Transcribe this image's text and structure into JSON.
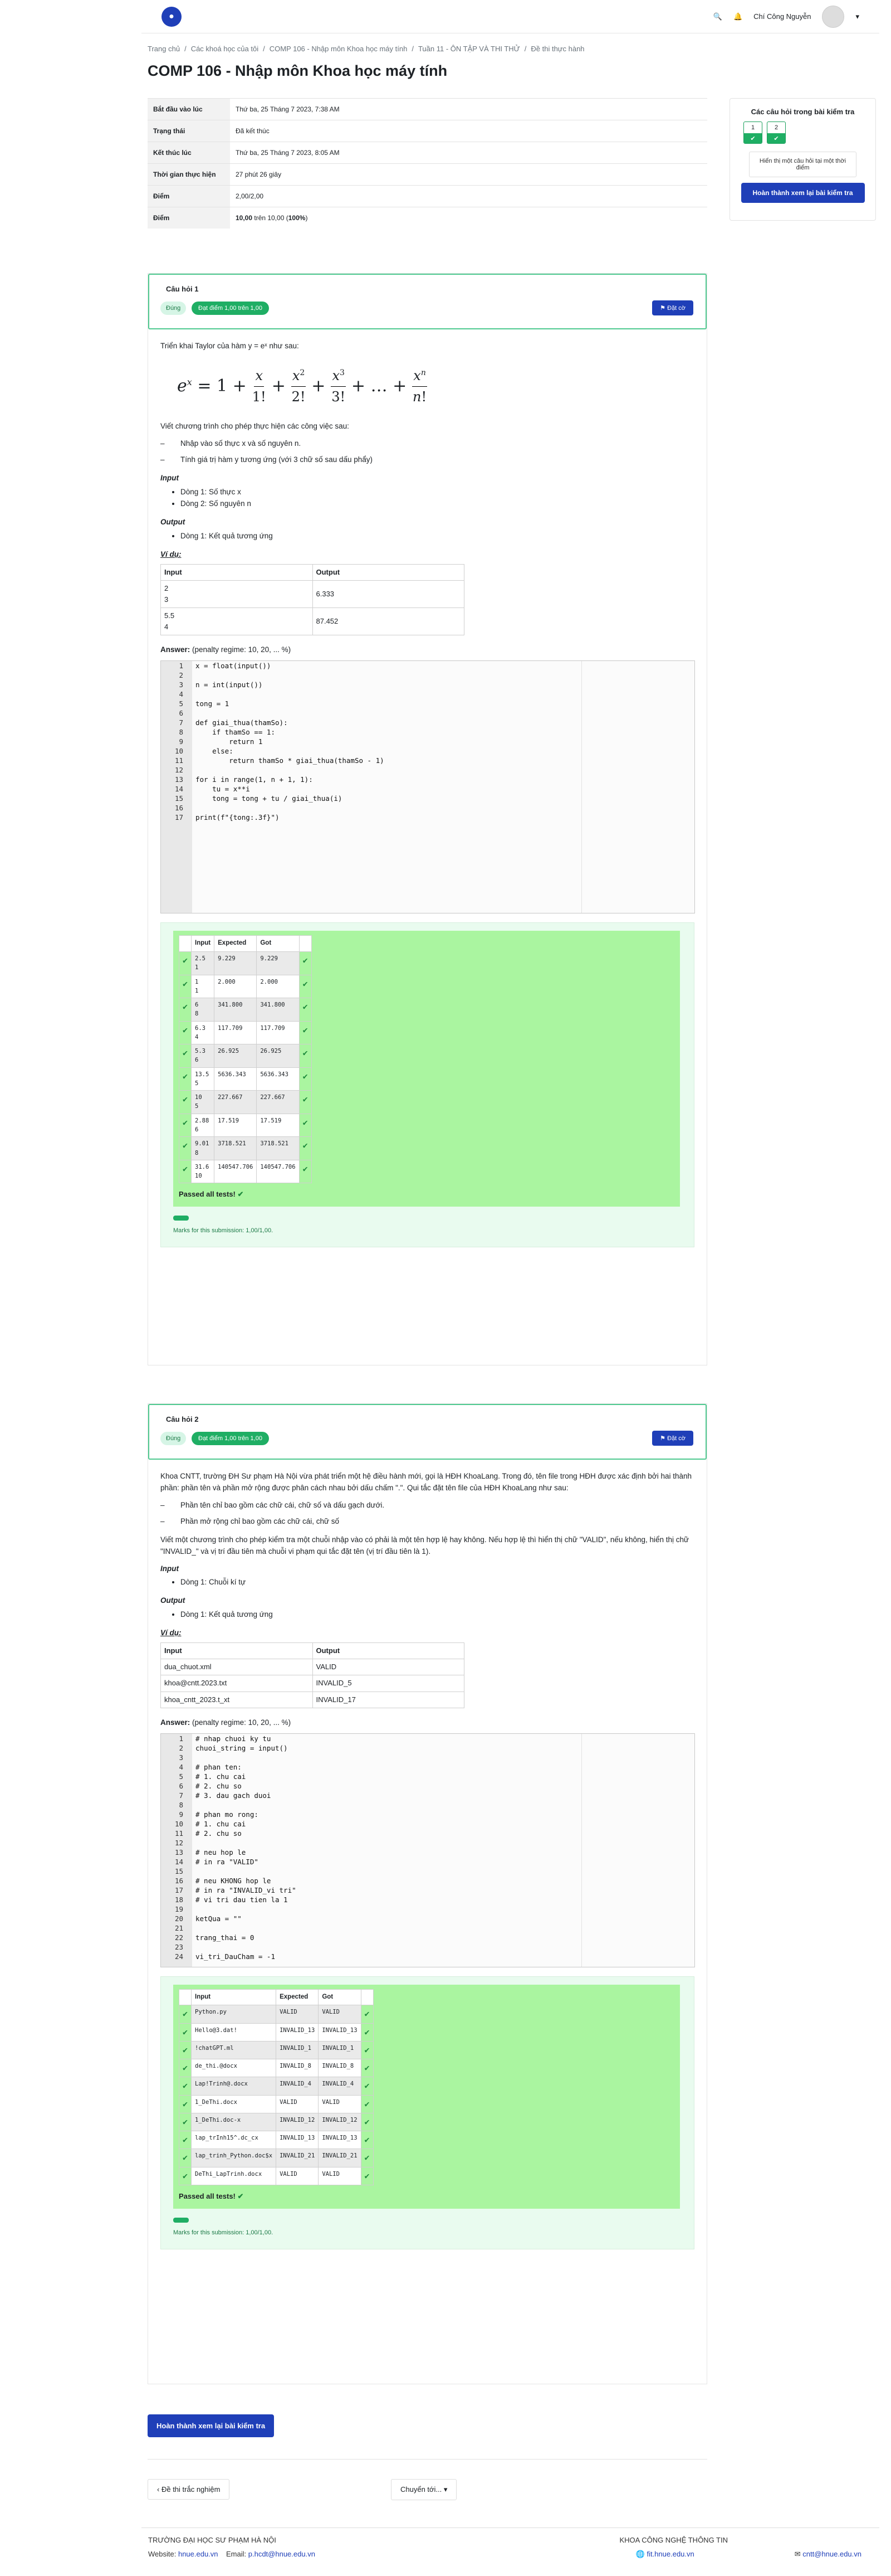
{
  "header": {
    "user": "Chí Công Nguyễn"
  },
  "breadcrumb": [
    "Trang chủ",
    "/",
    "Các khoá học của tôi",
    "/",
    "COMP 106 - Nhập môn Khoa học máy tính",
    "/",
    "Tuần 11 - ÔN TẬP VÀ THI THỬ",
    "/",
    "Đề thi thực hành"
  ],
  "page_title": "COMP 106 - Nhập môn Khoa học máy tính",
  "summary": [
    {
      "k": "Bắt đầu vào lúc",
      "v": "Thứ ba, 25 Tháng 7 2023, 7:38 AM"
    },
    {
      "k": "Trạng thái",
      "v": "Đã kết thúc"
    },
    {
      "k": "Kết thúc lúc",
      "v": "Thứ ba, 25 Tháng 7 2023, 8:05 AM"
    },
    {
      "k": "Thời gian thực hiện",
      "v": "27 phút 26 giây"
    },
    {
      "k": "Điểm",
      "v": "2,00/2,00"
    },
    {
      "k": "Điểm",
      "v": "10,00 trên 10,00 (100%)"
    }
  ],
  "nav": {
    "title": "Các câu hỏi trong bài kiểm tra",
    "buttons": [
      "1",
      "2"
    ],
    "show_one": "Hiển thị một câu hỏi tại một thời điểm",
    "finish": "Hoàn thành xem lại bài kiểm tra"
  },
  "q1": {
    "number": "Câu hỏi 1",
    "state": "Đúng",
    "grade": "Đạt điểm 1,00 trên 1,00",
    "flag": "Đặt cờ",
    "intro": "Triển khai Taylor của hàm y = eˣ như sau:",
    "task": "Viết chương trình cho phép thực hiện các công việc sau:",
    "tasks": [
      "Nhập vào số thực x và số nguyên n.",
      "Tính giá trị hàm y tương ứng (với 3 chữ số sau dấu phẩy)"
    ],
    "input_h": "Input",
    "inputs": [
      "Dòng 1: Số thực x",
      "Dòng 2: Số nguyên n"
    ],
    "output_h": "Output",
    "outputs": [
      "Dòng 1: Kết quả tương ứng"
    ],
    "vidu": "Ví dụ:",
    "io_head": [
      "Input",
      "Output"
    ],
    "io_rows": [
      [
        "2",
        "3",
        "6.333"
      ],
      [
        "5.5",
        "4",
        "87.452"
      ]
    ],
    "answer": "Answer:",
    "penalty": "(penalty regime: 10, 20, ... %)",
    "code": [
      "x = float(input())",
      "",
      "n = int(input())",
      "",
      "tong = 1",
      "",
      "def giai_thua(thamSo):",
      "    if thamSo == 1:",
      "        return 1",
      "    else:",
      "        return thamSo * giai_thua(thamSo - 1)",
      "",
      "for i in range(1, n + 1, 1):",
      "    tu = x**i",
      "    tong = tong + tu / giai_thua(i)",
      "",
      "print(f\"{tong:.3f}\")"
    ],
    "tc_head": [
      "Input",
      "Expected",
      "Got"
    ],
    "tests": [
      [
        "2.5",
        "1",
        "9.229",
        "9.229"
      ],
      [
        "1",
        "1",
        "2.000",
        "2.000"
      ],
      [
        "6",
        "8",
        "341.800",
        "341.800"
      ],
      [
        "6.3",
        "4",
        "117.709",
        "117.709"
      ],
      [
        "5.3",
        "6",
        "26.925",
        "26.925"
      ],
      [
        "13.5",
        "5",
        "5636.343",
        "5636.343"
      ],
      [
        "10",
        "5",
        "227.667",
        "227.667"
      ],
      [
        "2.88",
        "6",
        "17.519",
        "17.519"
      ],
      [
        "9.01",
        "8",
        "3718.521",
        "3718.521"
      ],
      [
        "31.6",
        "10",
        "140547.706",
        "140547.706"
      ]
    ],
    "passed": "Passed all tests!",
    "marks": "Marks for this submission: 1,00/1,00."
  },
  "q2": {
    "number": "Câu hỏi 2",
    "state": "Đúng",
    "grade": "Đạt điểm 1,00 trên 1,00",
    "flag": "Đặt cờ",
    "p1": "Khoa CNTT, trường ĐH Sư phạm Hà Nội vừa phát triển một hệ điều hành mới, gọi là HĐH KhoaLang. Trong đó, tên file trong HĐH được xác định bởi hai thành phần: phần tên và phần mở rộng được phân cách nhau bởi dấu chấm \".\". Qui tắc đặt tên file của HĐH KhoaLang như sau:",
    "rules": [
      "Phần tên chỉ bao gồm các chữ cái, chữ số và dấu gạch dưới.",
      "Phần mở rộng chỉ bao gồm các chữ cái, chữ số"
    ],
    "p2": "Viết một chương trình cho phép kiểm tra một chuỗi nhập vào có phải là một tên hợp lệ hay không. Nếu hợp lệ thì hiển thị chữ \"VALID\", nếu không, hiển thị chữ \"INVALID_\" và vị trí đầu tiên mà chuỗi vi phạm qui tắc đặt tên (vị trí đầu tiên là 1).",
    "input_h": "Input",
    "inputs": [
      "Dòng 1: Chuỗi kí tự"
    ],
    "output_h": "Output",
    "outputs": [
      "Dòng 1: Kết quả tương ứng"
    ],
    "vidu": "Ví dụ:",
    "io_head": [
      "Input",
      "Output"
    ],
    "io_rows": [
      [
        "dua_chuot.xml",
        "VALID"
      ],
      [
        "khoa@cntt.2023.txt",
        "INVALID_5"
      ],
      [
        "khoa_cntt_2023.t_xt",
        "INVALID_17"
      ]
    ],
    "answer": "Answer:",
    "penalty": "(penalty regime: 10, 20, ... %)",
    "code": [
      "# nhap chuoi ky tu",
      "chuoi_string = input()",
      "",
      "# phan ten:",
      "# 1. chu cai",
      "# 2. chu so",
      "# 3. dau gach duoi",
      "",
      "# phan mo rong:",
      "# 1. chu cai",
      "# 2. chu so",
      "",
      "# neu hop le",
      "# in ra \"VALID\"",
      "",
      "# neu KHONG hop le",
      "# in ra \"INVALID_vi tri\"",
      "# vi tri dau tien la 1",
      "",
      "ketQua = \"\"",
      "",
      "trang_thai = 0",
      "",
      "vi_tri_DauCham = -1"
    ],
    "tc_head": [
      "Input",
      "Expected",
      "Got"
    ],
    "tests": [
      [
        "Python.py",
        "VALID",
        "VALID"
      ],
      [
        "Hello@3.dat!",
        "INVALID_13",
        "INVALID_13"
      ],
      [
        "!chatGPT.ml",
        "INVALID_1",
        "INVALID_1"
      ],
      [
        "de_thi.@docx",
        "INVALID_8",
        "INVALID_8"
      ],
      [
        "Lap!Trinh@.docx",
        "INVALID_4",
        "INVALID_4"
      ],
      [
        "1_DeThi.docx",
        "VALID",
        "VALID"
      ],
      [
        "1_DeThi.doc-x",
        "INVALID_12",
        "INVALID_12"
      ],
      [
        "lap_trInh15^.dc_cx",
        "INVALID_13",
        "INVALID_13"
      ],
      [
        "lap_trinh_Python.doc$x",
        "INVALID_21",
        "INVALID_21"
      ],
      [
        "DeThi_LapTrinh.docx",
        "VALID",
        "VALID"
      ]
    ],
    "passed": "Passed all tests!",
    "marks": "Marks for this submission: 1,00/1,00."
  },
  "finish_review": "Hoàn thành xem lại bài kiểm tra",
  "prev_link": "Đề thi trắc nghiệm",
  "jump": "Chuyển tới...",
  "footer": {
    "school": "TRƯỜNG ĐẠI HỌC SƯ PHẠM HÀ NỘI",
    "faculty": "KHOA CÔNG NGHỆ THÔNG TIN",
    "website_label": "Website:",
    "website": "hnue.edu.vn",
    "email_label": "Email:",
    "email": "p.hcdt@hnue.edu.vn",
    "fit": "fit.hnue.edu.vn",
    "cntt": "cntt@hnue.edu.vn"
  }
}
